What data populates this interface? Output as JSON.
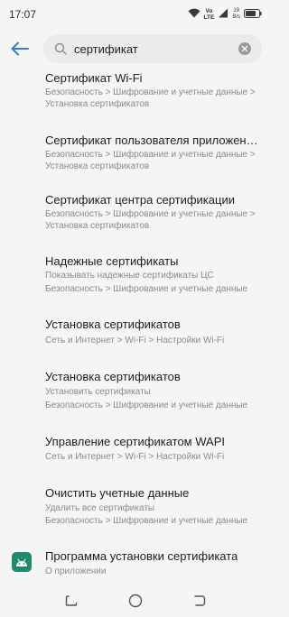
{
  "status": {
    "time": "17:07",
    "volte": "Vo",
    "lte": "LTE",
    "speed_value": "19",
    "speed_unit": "B/s"
  },
  "search": {
    "query": "сертификат"
  },
  "results": [
    {
      "title": "Сертификат Wi-Fi",
      "lines": [
        "Безопасность > Шифрование и учетные данные >",
        "Установка сертификатов"
      ]
    },
    {
      "title": "Сертификат пользователя приложени..",
      "lines": [
        "Безопасность > Шифрование и учетные данные >",
        "Установка сертификатов"
      ]
    },
    {
      "title": "Сертификат центра сертификации",
      "lines": [
        "Безопасность > Шифрование и учетные данные >",
        "Установка сертификатов"
      ]
    },
    {
      "title": "Надежные сертификаты",
      "lines": [
        "Показывать надежные сертификаты ЦС",
        "Безопасность > Шифрование и учетные данные"
      ]
    },
    {
      "title": "Установка сертификатов",
      "lines": [
        "Сеть и Интернет > Wi-Fi > Настройки Wi-Fi"
      ]
    },
    {
      "title": "Установка сертификатов",
      "lines": [
        "Установить сертификаты",
        "Безопасность > Шифрование и учетные данные"
      ]
    },
    {
      "title": "Управление сертификатом WAPI",
      "lines": [
        "Сеть и Интернет > Wi-Fi > Настройки Wi-Fi"
      ]
    },
    {
      "title": "Очистить учетные данные",
      "lines": [
        "Удалить все сертификаты",
        "Безопасность > Шифрование и учетные данные"
      ]
    },
    {
      "title": "Программа установки сертификата",
      "lines": [
        "О приложении"
      ]
    }
  ],
  "colors": {
    "accent": "#2f7fd8",
    "app_icon": "#1f8a6c"
  }
}
